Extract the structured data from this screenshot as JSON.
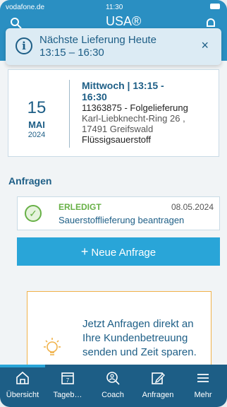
{
  "status": {
    "carrier": "vodafone.de",
    "time": "11:30"
  },
  "header": {
    "logo": "USA®",
    "left_icon": "search-icon",
    "right_icon": "bell-icon"
  },
  "banner": {
    "line1": "Nächste Lieferung Heute",
    "line2": "13:15 – 16:30",
    "close": "×"
  },
  "delivery": {
    "day": "15",
    "month": "MAI",
    "year": "2024",
    "title_line1": "Mittwoch  | 13:15 -",
    "title_line2": "16:30",
    "order": "11363875 - Folgelieferung",
    "address1": "Karl-Liebknecht-Ring 26 ,",
    "address2": "17491 Greifswald",
    "product": "Flüssigsauerstoff"
  },
  "requests": {
    "title": "Anfragen",
    "items": [
      {
        "status": "ERLEDIGT",
        "date": "08.05.2024",
        "description": "Sauerstofflieferung beantragen",
        "status_color": "#67b046"
      }
    ],
    "new_button": "Neue Anfrage"
  },
  "promo": {
    "text": "Jetzt Anfragen direkt an Ihre Kundenbetreuung senden und Zeit sparen."
  },
  "tabs": [
    {
      "label": "Übersicht",
      "icon": "home-icon"
    },
    {
      "label": "Tageb…",
      "icon": "calendar-icon",
      "icon_text": "7"
    },
    {
      "label": "Coach",
      "icon": "coach-icon"
    },
    {
      "label": "Anfragen",
      "icon": "edit-icon"
    },
    {
      "label": "Mehr",
      "icon": "menu-icon"
    }
  ],
  "colors": {
    "primary": "#1d5e86",
    "accent": "#29a5d8",
    "success": "#67b046",
    "highlight": "#f0b24a"
  }
}
